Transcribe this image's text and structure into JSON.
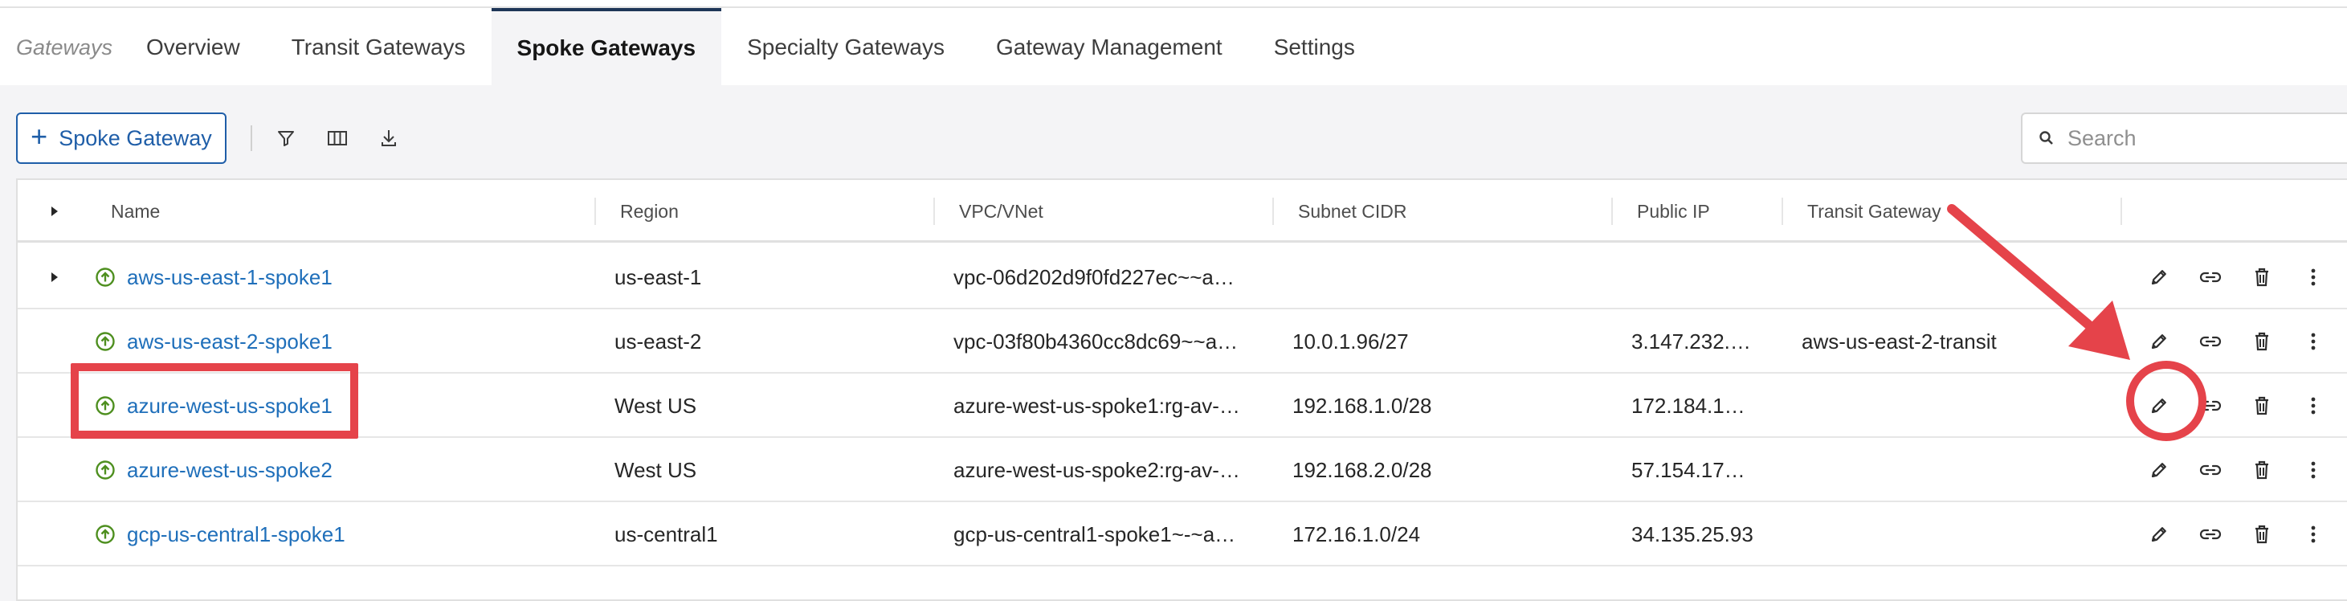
{
  "tabs": {
    "section": "Gateways",
    "items": [
      "Overview",
      "Transit Gateways",
      "Spoke Gateways",
      "Specialty Gateways",
      "Gateway Management",
      "Settings"
    ],
    "active": "Spoke Gateways"
  },
  "toolbar": {
    "add_label": "Spoke Gateway",
    "icons": [
      "filter-icon",
      "columns-icon",
      "download-icon"
    ],
    "search_placeholder": "Search"
  },
  "table": {
    "columns": [
      "Name",
      "Region",
      "VPC/VNet",
      "Subnet CIDR",
      "Public IP",
      "Transit Gateway"
    ],
    "rows": [
      {
        "name": "aws-us-east-1-spoke1",
        "region": "us-east-1",
        "vpc": "vpc-06d202d9f0fd227ec~~a…",
        "subnet": "",
        "public_ip": "",
        "transit": "",
        "expandable": true
      },
      {
        "name": "aws-us-east-2-spoke1",
        "region": "us-east-2",
        "vpc": "vpc-03f80b4360cc8dc69~~a…",
        "subnet": "10.0.1.96/27",
        "public_ip": "3.147.232.…",
        "transit": "aws-us-east-2-transit",
        "expandable": false
      },
      {
        "name": "azure-west-us-spoke1",
        "region": "West US",
        "vpc": "azure-west-us-spoke1:rg-av-…",
        "subnet": "192.168.1.0/28",
        "public_ip": "172.184.1…",
        "transit": "",
        "expandable": false
      },
      {
        "name": "azure-west-us-spoke2",
        "region": "West US",
        "vpc": "azure-west-us-spoke2:rg-av-…",
        "subnet": "192.168.2.0/28",
        "public_ip": "57.154.17…",
        "transit": "",
        "expandable": false
      },
      {
        "name": "gcp-us-central1-spoke1",
        "region": "us-central1",
        "vpc": "gcp-us-central1-spoke1~-~a…",
        "subnet": "172.16.1.0/24",
        "public_ip": "34.135.25.93",
        "transit": "",
        "expandable": false
      }
    ],
    "row_actions": [
      "edit-icon",
      "link-icon",
      "delete-icon",
      "more-icon"
    ]
  },
  "colors": {
    "accent": "#1f5ea8",
    "link": "#1f6fba",
    "status_ok": "#4e8f1f",
    "annotation": "#e5434a",
    "background": "#f4f4f6"
  }
}
